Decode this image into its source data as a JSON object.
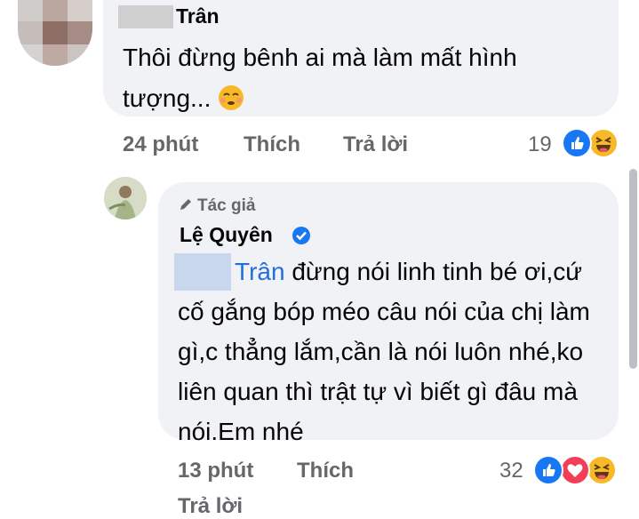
{
  "comment": {
    "author_name": "Trân",
    "text": "Thôi đừng bênh ai mà làm mất hình tượng...",
    "emoji_icon": "relieved-face-emoji",
    "time": "24 phút",
    "like_label": "Thích",
    "reply_label": "Trả lời",
    "reaction_count": "19",
    "reaction_icons": [
      "like-icon",
      "haha-icon"
    ]
  },
  "reply": {
    "badge": "Tác giả",
    "author_name": "Lệ Quyên",
    "mention": "Trân",
    "text": " đừng nói linh tinh bé ơi,cứ cố gắng bóp méo câu nói của chị làm gì,c thẳng lắm,cần là nói luôn nhé,ko liên quan thì trật tự vì biết gì đâu mà nói.Em nhé",
    "time": "13 phút",
    "like_label": "Thích",
    "reply_label": "Trả lời",
    "reaction_count": "32",
    "reaction_icons": [
      "like-icon",
      "love-icon",
      "haha-icon"
    ]
  },
  "colors": {
    "bubble": "#f0f2f5",
    "meta_text": "#65676b",
    "mention": "#216fdb",
    "like_blue": "#1877f2",
    "love_red": "#f33e58",
    "haha_yellow": "#f7b928"
  }
}
